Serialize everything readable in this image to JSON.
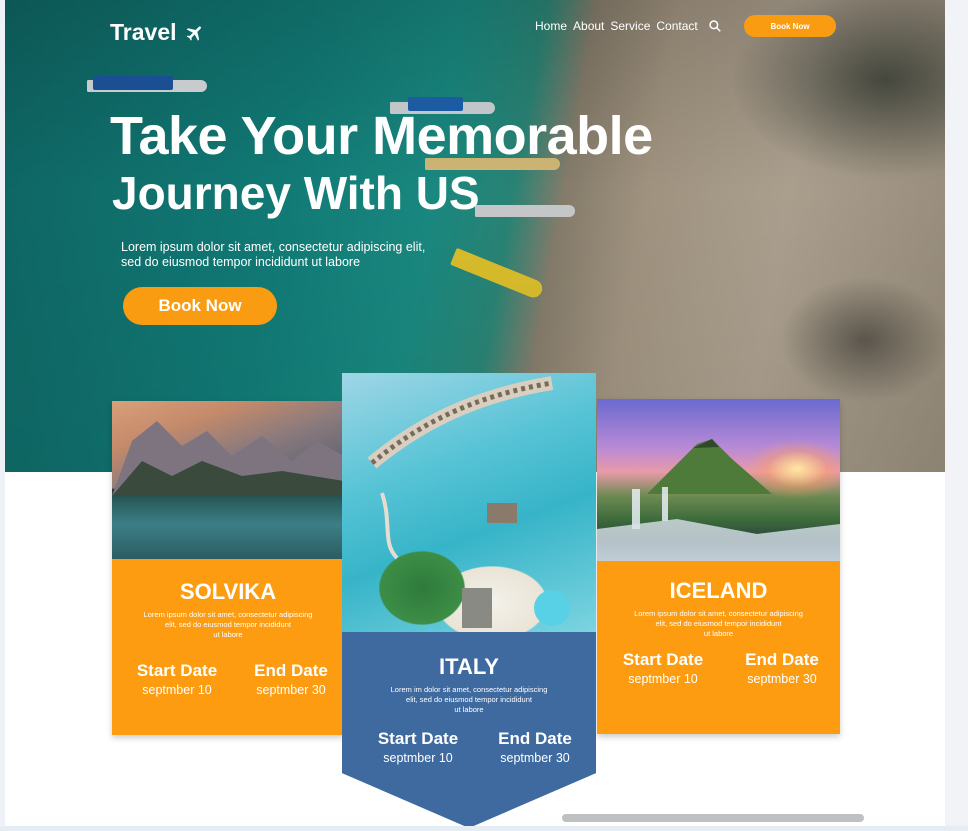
{
  "nav": {
    "logo": "Travel",
    "links": [
      "Home",
      "About",
      "Service",
      "Contact"
    ],
    "book_label": "Book Now"
  },
  "hero": {
    "title_line1": "Take Your Memorable",
    "title_line2": "Journey With US",
    "subtitle": "Lorem ipsum dolor sit amet, consectetur adipiscing elit,\n sed do eiusmod tempor incididunt ut labore",
    "book_label": "Book Now"
  },
  "cards": [
    {
      "title": "SOLVIKA",
      "desc": "Lorem ipsum dolor sit amet, consectetur adipiscing\nelit, sed do eiusmod tempor incididunt\nut labore",
      "start_label": "Start Date",
      "start_value": "septmber 10",
      "end_label": "End Date",
      "end_value": "septmber 30"
    },
    {
      "title": "ITALY",
      "desc": "Lorem im dolor sit amet, consectetur adipiscing\nelit, sed do eiusmod tempor incididunt\nut labore",
      "start_label": "Start Date",
      "start_value": "septmber 10",
      "end_label": "End Date",
      "end_value": "septmber 30"
    },
    {
      "title": "ICELAND",
      "desc": "Lorem ipsum dolor sit amet, consectetur adipiscing\nelit, sed do eiusmod tempor incididunt\nut labore",
      "start_label": "Start Date",
      "start_value": "septmber 10",
      "end_label": "End Date",
      "end_value": "septmber 30"
    }
  ],
  "colors": {
    "accent": "#fd9c10",
    "italy_card": "#3e6aa0"
  },
  "icons": [
    "plane-icon",
    "search-icon"
  ]
}
